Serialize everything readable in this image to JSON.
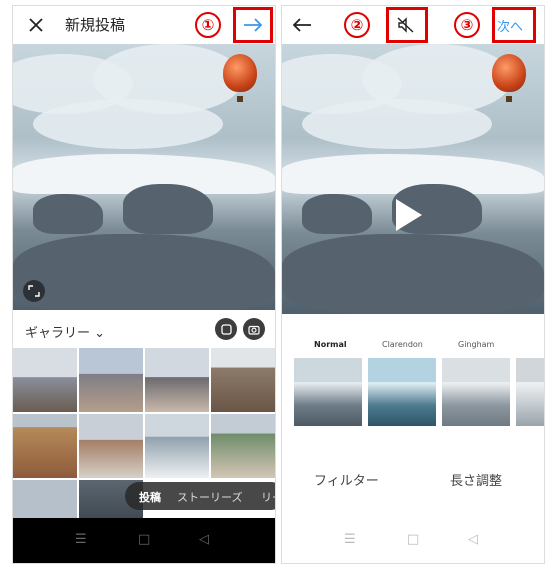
{
  "left": {
    "title": "新規投稿",
    "gallery_label": "ギャラリー",
    "tabs": [
      "投稿",
      "ストーリーズ",
      "リー"
    ]
  },
  "right": {
    "next_label": "次へ",
    "filters": [
      "Normal",
      "Clarendon",
      "Gingham"
    ],
    "bottom_tabs": [
      "フィルター",
      "長さ調整"
    ]
  },
  "markers": [
    "①",
    "②",
    "③"
  ],
  "nav": {
    "menu_glyph": "☰",
    "home_glyph": "□",
    "back_glyph": "◁"
  },
  "colors": {
    "accent": "#3897f0",
    "marker": "#e00000"
  }
}
